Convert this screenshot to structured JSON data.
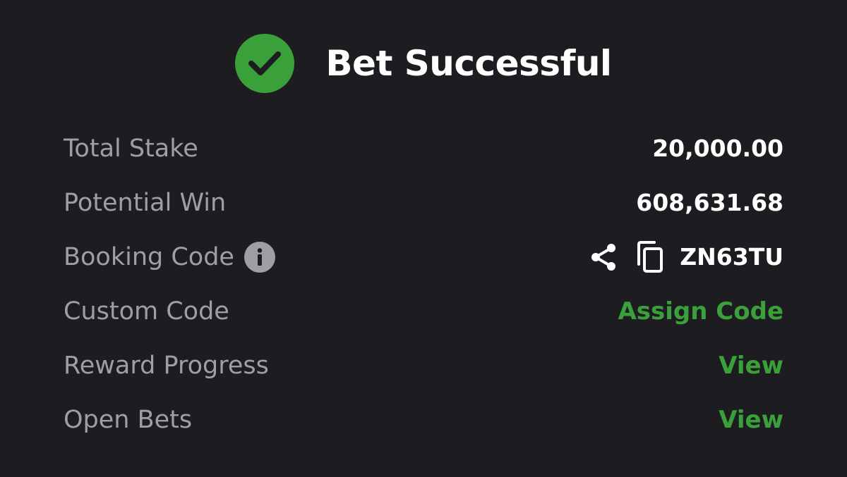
{
  "header": {
    "title": "Bet Successful",
    "status_icon": "check-circle-icon",
    "accent_color": "#3aa13a"
  },
  "rows": [
    {
      "label": "Total Stake",
      "value": "20,000.00"
    },
    {
      "label": "Potential Win",
      "value": "608,631.68"
    },
    {
      "label": "Booking Code",
      "value": "ZN63TU",
      "icons": [
        "info-icon",
        "share-icon",
        "copy-icon"
      ]
    },
    {
      "label": "Custom Code",
      "value": "Assign Code"
    },
    {
      "label": "Reward Progress",
      "value": "View"
    },
    {
      "label": "Open Bets",
      "value": "View"
    }
  ],
  "colors": {
    "background": "#1d1d21",
    "label": "#9e9fa6",
    "value": "#ffffff",
    "link": "#3aa13a"
  }
}
